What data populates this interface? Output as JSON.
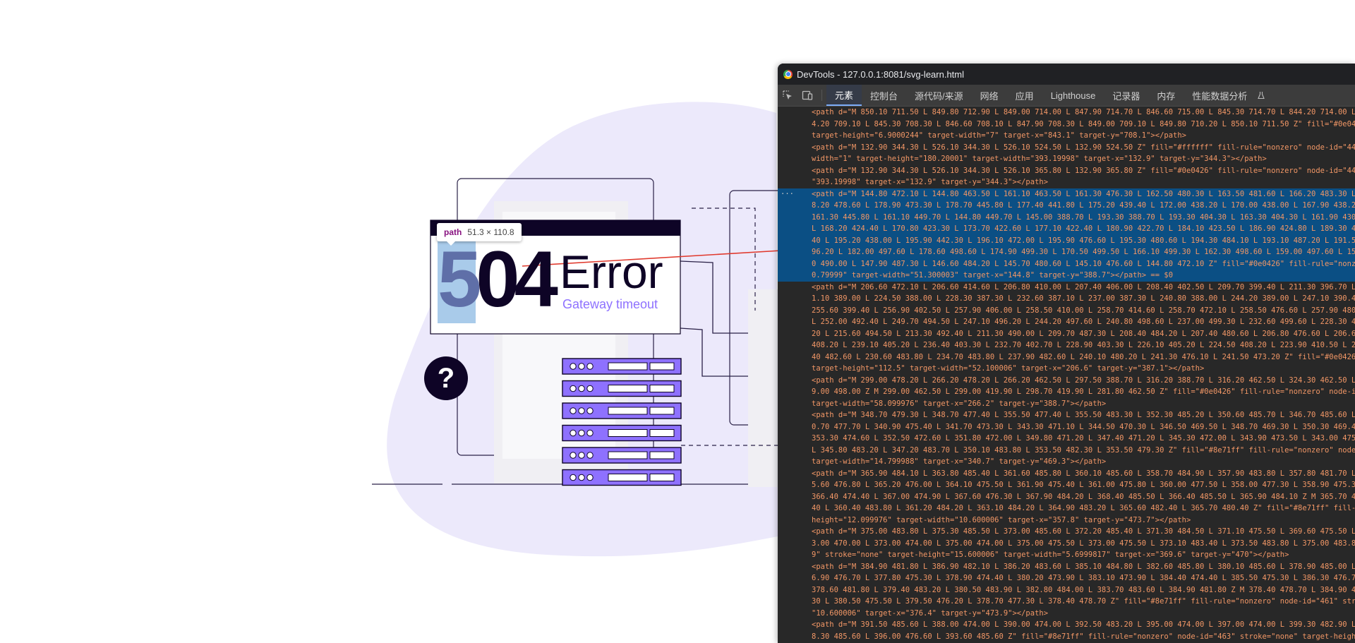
{
  "colors": {
    "blob": "#ece9fb",
    "dark": "#0e0426",
    "accent": "#8e71ff",
    "highlight": "#6fa8dc",
    "arrow": "#e03a2e",
    "devtools_bg": "#282828",
    "selected_row": "#0b4f84",
    "attr_value": "#f29766"
  },
  "illustration": {
    "tooltip_tag": "path",
    "tooltip_size": "51.3 × 110.8",
    "error_code_highlight": "5",
    "error_code_rest": "04",
    "error_word": "Error",
    "error_subtitle": "Gateway timeout",
    "help_glyph": "?"
  },
  "devtools": {
    "window_title": "DevTools - 127.0.0.1:8081/svg-learn.html",
    "icons": [
      "inspect-element-icon",
      "device-toolbar-icon"
    ],
    "tabs": [
      {
        "label": "元素",
        "active": true
      },
      {
        "label": "控制台",
        "active": false
      },
      {
        "label": "源代码/来源",
        "active": false
      },
      {
        "label": "网络",
        "active": false
      },
      {
        "label": "应用",
        "active": false
      },
      {
        "label": "Lighthouse",
        "active": false
      },
      {
        "label": "记录器",
        "active": false
      },
      {
        "label": "内存",
        "active": false
      },
      {
        "label": "性能数据分析",
        "active": false
      }
    ],
    "code_lines": [
      "<path d=\"M 850.10 711.50 L 849.80 712.90 L 849.00 714.00 L 847.90 714.70 L 846.60 715.00 L 845.30 714.70 L 844.20 714.00 L 843.4",
      "4.20 709.10 L 845.30 708.30 L 846.60 708.10 L 847.90 708.30 L 849.00 709.10 L 849.80 710.20 L 850.10 711.50 Z\" fill=\"#0e0426\" fi",
      "target-height=\"6.9000244\" target-width=\"7\" target-x=\"843.1\" target-y=\"708.1\"></path>",
      "<path d=\"M 132.90 344.30 L 526.10 344.30 L 526.10 524.50 L 132.90 524.50 Z\" fill=\"#ffffff\" fill-rule=\"nonzero\" node-id=\"445\" str",
      "width=\"1\" target-height=\"180.20001\" target-width=\"393.19998\" target-x=\"132.9\" target-y=\"344.3\"></path>",
      "<path d=\"M 132.90 344.30 L 526.10 344.30 L 526.10 365.80 L 132.90 365.80 Z\" fill=\"#0e0426\" fill-rule=\"nonzero\" node-id=\"447\" str",
      "\"393.19998\" target-x=\"132.9\" target-y=\"344.3\"></path>",
      "<path d=\"M 144.80 472.10 L 144.80 463.50 L 161.10 463.50 L 161.30 476.30 L 162.50 480.30 L 163.50 481.60 L 166.20 483.30 L 170.0",
      "8.20 478.60 L 178.90 473.30 L 178.70 445.80 L 177.40 441.80 L 175.20 439.40 L 172.00 438.20 L 170.00 438.00 L 167.90 438.20 L 16",
      "161.30 445.80 L 161.10 449.70 L 144.80 449.70 L 145.00 388.70 L 193.30 388.70 L 193.30 404.30 L 163.30 404.30 L 161.90 430.40 L",
      "L 168.20 424.40 L 170.80 423.30 L 173.70 422.60 L 177.10 422.40 L 180.90 422.70 L 184.10 423.50 L 186.90 424.80 L 189.30 426.60",
      "40 L 195.20 438.00 L 195.90 442.30 L 196.10 472.00 L 195.90 476.60 L 195.30 480.60 L 194.30 484.10 L 193.10 487.20 L 191.50 490.",
      "96.20 L 182.00 497.60 L 178.60 498.60 L 174.90 499.30 L 170.50 499.50 L 166.10 499.30 L 162.30 498.60 L 159.00 497.60 L 156.10 4",
      "0 490.00 L 147.90 487.30 L 146.60 484.20 L 145.70 480.60 L 145.10 476.60 L 144.80 472.10 Z\" fill=\"#0e0426\" fill-rule=\"nonzero\" n",
      "0.79999\" target-width=\"51.300003\" target-x=\"144.8\" target-y=\"388.7\"></path> == $0",
      "<path d=\"M 206.60 472.10 L 206.60 414.60 L 206.80 410.00 L 207.40 406.00 L 208.40 402.50 L 209.70 399.40 L 211.30 396.70 L 213.3",
      "1.10 389.00 L 224.50 388.00 L 228.30 387.30 L 232.60 387.10 L 237.00 387.30 L 240.80 388.00 L 244.20 389.00 L 247.10 390.40 L 24",
      "255.60 399.40 L 256.90 402.50 L 257.90 406.00 L 258.50 410.00 L 258.70 414.60 L 258.70 472.10 L 258.50 476.60 L 257.90 480.60 L",
      "L 252.00 492.40 L 249.70 494.50 L 247.10 496.20 L 244.20 497.60 L 240.80 498.60 L 237.00 499.30 L 232.60 499.60 L 228.30 499.30",
      "20 L 215.60 494.50 L 213.30 492.40 L 211.30 490.00 L 209.70 487.30 L 208.40 484.20 L 207.40 480.60 L 206.80 476.60 L 206.60 472.",
      "408.20 L 239.10 405.20 L 236.40 403.30 L 232.70 402.70 L 228.90 403.30 L 226.10 405.20 L 224.50 408.20 L 223.90 410.50 L 223.70",
      "40 482.60 L 230.60 483.80 L 234.70 483.80 L 237.90 482.60 L 240.10 480.20 L 241.30 476.10 L 241.50 473.20 Z\" fill=\"#0e0426\" fill",
      "target-height=\"112.5\" target-width=\"52.100006\" target-x=\"206.6\" target-y=\"387.1\"></path>",
      "<path d=\"M 299.00 478.20 L 266.20 478.20 L 266.20 462.50 L 297.50 388.70 L 316.20 388.70 L 316.20 462.50 L 324.30 462.50 L 324.3",
      "9.00 498.00 Z M 299.00 462.50 L 299.00 419.90 L 298.70 419.90 L 281.80 462.50 Z\" fill=\"#0e0426\" fill-rule=\"nonzero\" node-id=\"453",
      "target-width=\"58.099976\" target-x=\"266.2\" target-y=\"388.7\"></path>",
      "<path d=\"M 348.70 479.30 L 348.70 477.40 L 355.50 477.40 L 355.50 483.30 L 352.30 485.20 L 350.60 485.70 L 346.70 485.60 L 344.6",
      "0.70 477.70 L 340.90 475.40 L 341.70 473.30 L 343.30 471.10 L 344.50 470.30 L 346.50 469.50 L 348.70 469.30 L 350.30 469.40 L 35",
      "353.30 474.60 L 352.50 472.60 L 351.80 472.00 L 349.80 471.20 L 347.40 471.20 L 345.30 472.00 L 343.90 473.50 L 343.00 475.90 L",
      "L 345.80 483.20 L 347.20 483.70 L 350.10 483.80 L 353.50 482.30 L 353.50 479.30 Z\" fill=\"#8e71ff\" fill-rule=\"nonzero\" node-id=\"4",
      "target-width=\"14.799988\" target-x=\"340.7\" target-y=\"469.3\"></path>",
      "<path d=\"M 365.90 484.10 L 363.80 485.40 L 361.60 485.80 L 360.10 485.60 L 358.70 484.90 L 357.90 483.80 L 357.80 481.70 L 359.1",
      "5.60 476.80 L 365.20 476.00 L 364.10 475.50 L 361.90 475.40 L 361.00 475.80 L 360.00 477.50 L 358.00 477.30 L 358.90 475.30 L 36",
      "366.40 474.40 L 367.00 474.90 L 367.60 476.30 L 367.90 484.20 L 368.40 485.50 L 366.40 485.50 L 365.90 484.10 Z M 365.70 479.70",
      "40 L 360.40 483.80 L 361.20 484.20 L 363.10 484.20 L 364.90 483.20 L 365.60 482.40 L 365.70 480.40 Z\" fill=\"#8e71ff\" fill-rule=\"",
      "height=\"12.099976\" target-width=\"10.600006\" target-x=\"357.8\" target-y=\"473.7\"></path>",
      "<path d=\"M 375.00 483.80 L 375.30 485.50 L 373.00 485.60 L 372.20 485.40 L 371.30 484.50 L 371.10 475.50 L 369.60 475.50 L 369.6",
      "3.00 470.00 L 373.00 474.00 L 375.00 474.00 L 375.00 475.50 L 373.00 475.50 L 373.10 483.40 L 373.50 483.80 L 375.00 483.80 Z\" fi",
      "9\" stroke=\"none\" target-height=\"15.600006\" target-width=\"5.6999817\" target-x=\"369.6\" target-y=\"470\"></path>",
      "<path d=\"M 384.90 481.80 L 386.90 482.10 L 386.20 483.60 L 385.10 484.80 L 382.60 485.80 L 380.10 485.60 L 378.90 485.00 L 377.8",
      "6.90 476.70 L 377.80 475.30 L 378.90 474.40 L 380.20 473.90 L 383.10 473.90 L 384.40 474.40 L 385.50 475.30 L 386.30 476.70 L 38",
      "378.60 481.80 L 379.40 483.20 L 380.50 483.90 L 382.80 484.00 L 383.70 483.60 L 384.90 481.80 Z M 378.40 478.70 L 384.90 478.70",
      "30 L 380.50 475.50 L 379.50 476.20 L 378.70 477.30 L 378.40 478.70 Z\" fill=\"#8e71ff\" fill-rule=\"nonzero\" node-id=\"461\" stroke=\"n",
      "\"10.600006\" target-x=\"376.4\" target-y=\"473.9\"></path>",
      "<path d=\"M 391.50 485.60 L 388.00 474.00 L 390.00 474.00 L 392.50 483.20 L 395.00 474.00 L 397.00 474.00 L 399.30 482.90 L 402.0",
      "8.30 485.60 L 396.00 476.60 L 393.60 485.60 Z\" fill=\"#8e71ff\" fill-rule=\"nonzero\" node-id=\"463\" stroke=\"none\" target-height=\"11."
    ],
    "selected_rows": [
      7,
      8,
      9,
      10,
      11,
      12,
      13,
      14
    ],
    "selected_gutter": "···"
  }
}
